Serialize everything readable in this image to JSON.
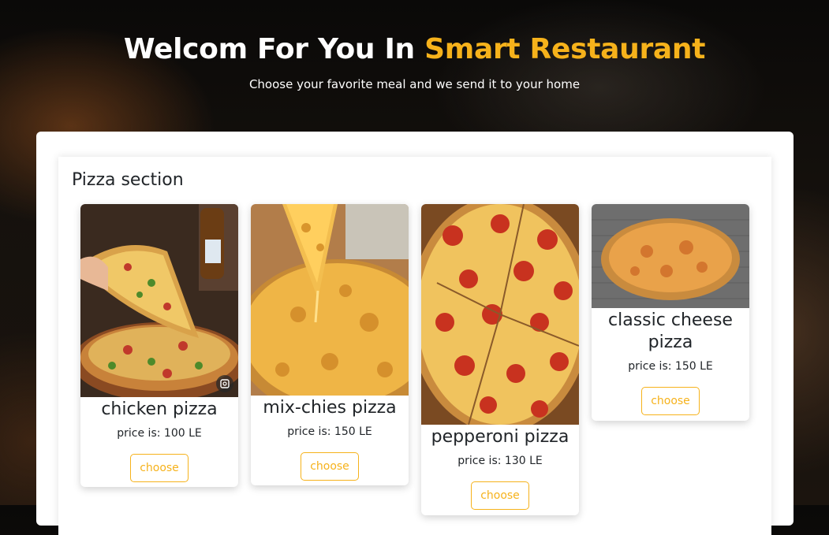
{
  "hero": {
    "title_prefix": "Welcom For You In ",
    "title_accent": "Smart Restaurant",
    "subtitle": "Choose your favorite meal and we send it to your home"
  },
  "section": {
    "title": "Pizza section"
  },
  "products": [
    {
      "name": "chicken pizza",
      "price": "price is: 100 LE",
      "button": "choose",
      "image": "chicken-pizza-photo"
    },
    {
      "name": "mix-chies pizza",
      "price": "price is: 150 LE",
      "button": "choose",
      "image": "mix-cheese-pizza-photo"
    },
    {
      "name": "pepperoni pizza",
      "price": "price is: 130 LE",
      "button": "choose",
      "image": "pepperoni-pizza-photo"
    },
    {
      "name": "classic cheese pizza",
      "price": "price is: 150 LE",
      "button": "choose",
      "image": "classic-cheese-pizza-photo"
    }
  ],
  "colors": {
    "accent": "#f6b21b",
    "text": "#212529"
  }
}
